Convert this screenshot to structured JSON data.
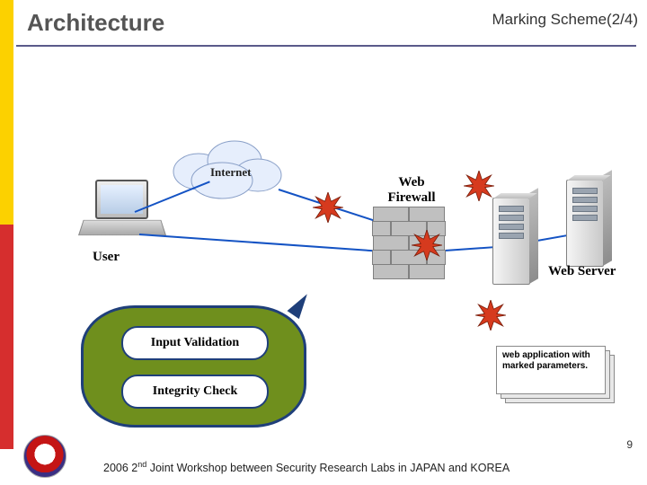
{
  "header": {
    "title": "Architecture",
    "scheme": "Marking Scheme(2/4)"
  },
  "diagram": {
    "internet_label": "Internet",
    "user_label": "User",
    "web_firewall_label": "Web Firewall",
    "web_server_label": "Web Server"
  },
  "callout": {
    "pill1": "Input Validation",
    "pill2": "Integrity Check"
  },
  "note": {
    "text": "web application with marked parameters."
  },
  "footer": {
    "line_prefix": "2006 2",
    "line_ord": "nd",
    "line_rest": " Joint Workshop between  Security Research Labs in JAPAN and KOREA",
    "slide_number": "9"
  }
}
